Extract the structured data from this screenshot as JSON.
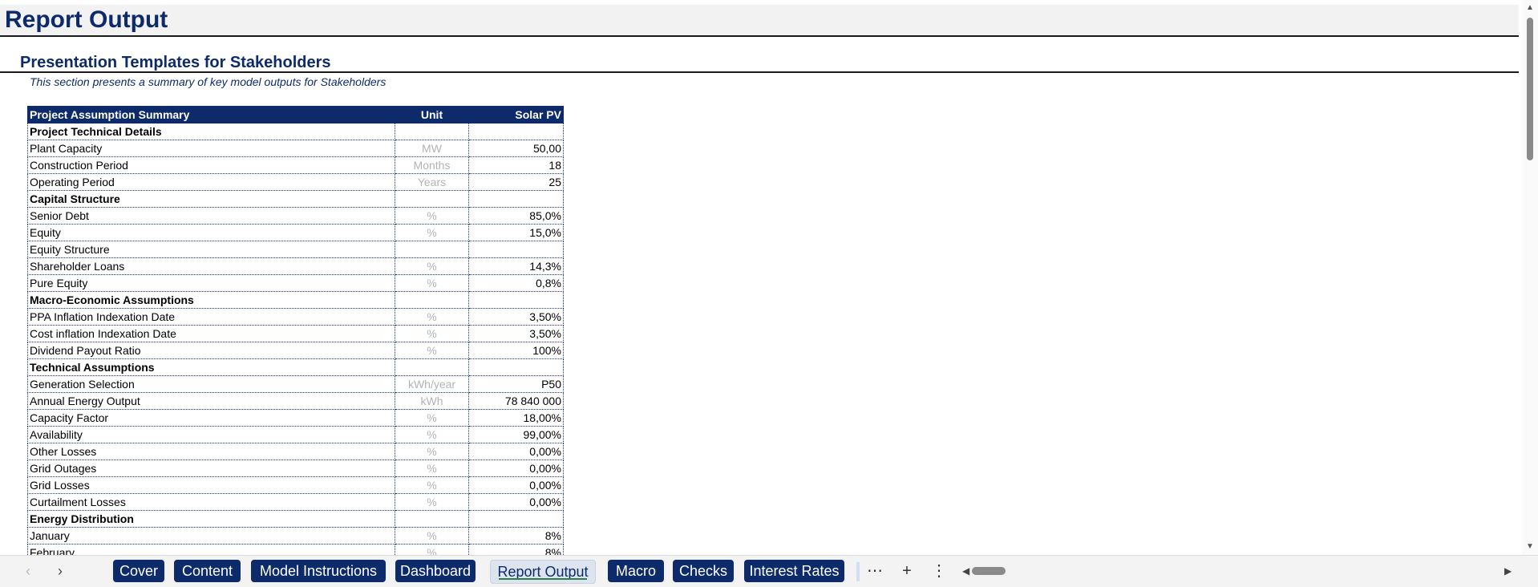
{
  "page": {
    "title": "Report Output",
    "section_title": "Presentation Templates for Stakeholders",
    "section_desc": "This section presents a summary of key model outputs for Stakeholders"
  },
  "table": {
    "headers": [
      "Project Assumption Summary",
      "Unit",
      "Solar PV"
    ],
    "rows": [
      {
        "label": "Project Technical Details",
        "unit": "",
        "value": "",
        "section": true
      },
      {
        "label": "Plant Capacity",
        "unit": "MW",
        "value": "50,00"
      },
      {
        "label": "Construction Period",
        "unit": "Months",
        "value": "18"
      },
      {
        "label": "Operating Period",
        "unit": "Years",
        "value": "25"
      },
      {
        "label": "Capital Structure",
        "unit": "",
        "value": "",
        "section": true
      },
      {
        "label": "Senior Debt",
        "unit": "%",
        "value": "85,0%"
      },
      {
        "label": "Equity",
        "unit": "%",
        "value": "15,0%"
      },
      {
        "label": "Equity Structure",
        "unit": "",
        "value": ""
      },
      {
        "label": "Shareholder Loans",
        "unit": "%",
        "value": "14,3%"
      },
      {
        "label": "Pure Equity",
        "unit": "%",
        "value": "0,8%"
      },
      {
        "label": "Macro-Economic Assumptions",
        "unit": "",
        "value": "",
        "section": true
      },
      {
        "label": "PPA Inflation Indexation Date",
        "unit": "%",
        "value": "3,50%"
      },
      {
        "label": "Cost inflation Indexation Date",
        "unit": "%",
        "value": "3,50%"
      },
      {
        "label": "Dividend Payout Ratio",
        "unit": "%",
        "value": "100%"
      },
      {
        "label": "Technical Assumptions",
        "unit": "",
        "value": "",
        "section": true
      },
      {
        "label": "Generation Selection",
        "unit": "kWh/year",
        "value": "P50"
      },
      {
        "label": "Annual Energy Output",
        "unit": "kWh",
        "value": "78 840 000"
      },
      {
        "label": "Capacity Factor",
        "unit": "%",
        "value": "18,00%"
      },
      {
        "label": "Availability",
        "unit": "%",
        "value": "99,00%"
      },
      {
        "label": "Other Losses",
        "unit": "%",
        "value": "0,00%"
      },
      {
        "label": "Grid Outages",
        "unit": "%",
        "value": "0,00%"
      },
      {
        "label": "Grid Losses",
        "unit": "%",
        "value": "0,00%"
      },
      {
        "label": "Curtailment Losses",
        "unit": "%",
        "value": "0,00%"
      },
      {
        "label": "Energy Distribution",
        "unit": "",
        "value": "",
        "section": true
      },
      {
        "label": "January",
        "unit": "%",
        "value": "8%"
      },
      {
        "label": "February",
        "unit": "%",
        "value": "8%"
      }
    ]
  },
  "tabs": {
    "items": [
      "Cover",
      "Content",
      "Model Instructions",
      "Dashboard",
      "Report Output",
      "Macro",
      "Checks",
      "Interest Rates"
    ],
    "active": "Report Output"
  },
  "toolbar": {
    "prev_icon": "chevron-left-icon",
    "next_icon": "chevron-right-icon",
    "more_tabs_icon": "ellipsis-icon",
    "add_sheet_icon": "plus-icon",
    "options_icon": "vertical-ellipsis-icon"
  },
  "colors": {
    "brand_navy": "#0d2b6b",
    "unit_gray": "#b3b3b3",
    "tab_active_bg": "#dde4ee",
    "tab_active_underline": "#2e7d4f"
  }
}
